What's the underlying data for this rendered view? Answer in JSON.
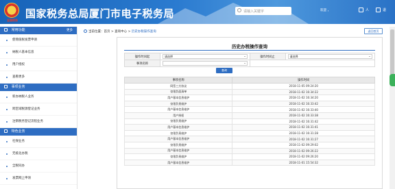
{
  "header": {
    "emblem_text": "全国税务",
    "title": "国家税务总局厦门市电子税务局",
    "search_placeholder": "请输入关键字",
    "search_button": "搜索",
    "welcome": "欢迎 ，",
    "user_label": "人",
    "logout_label": "退"
  },
  "sidebar": {
    "sections": [
      {
        "title": "常用功能",
        "more": "更多",
        "items": [
          "使增值税发票申请",
          "纳税人基本信息",
          "用户授权",
          "查看更多"
        ]
      },
      {
        "title": "事项业务",
        "items": [
          "新办纳税人业务",
          "跨区域税源登记业务",
          "注销税务登记流程业务"
        ]
      },
      {
        "title": "特色业务",
        "items": [
          "社保业务",
          "无纸化办税",
          "全税同办",
          "发票网上申领"
        ]
      }
    ]
  },
  "breadcrumb": {
    "label": "当前位置：",
    "home": "首页",
    "sep1": " > ",
    "center": "查询中心",
    "sep2": " > ",
    "current": "历史办税操作查询"
  },
  "back_button": "返回首页",
  "page_title": "历史办税操作查询",
  "form": {
    "time_start_label": "操作时间起",
    "time_start_value": "请选择",
    "time_end_label": "操作时间止",
    "time_end_value": "请选择",
    "item_label": "事项名称",
    "item_value": "",
    "query_button": "查询"
  },
  "grid": {
    "columns": [
      "事项名称",
      "操作时间"
    ],
    "rows": [
      [
        "网签三方协议",
        "2018-11-05 09:24:20"
      ],
      [
        "仅限负面清单",
        "2018-11-02 16:34:22"
      ],
      [
        "用户基本信息维护",
        "2018-11-02 16:34:20"
      ],
      [
        "仅限负责维护",
        "2018-11-02 16:33:42"
      ],
      [
        "用户基本信息维护",
        "2018-11-02 16:33:40"
      ],
      [
        "用户授权",
        "2018-11-02 16:33:38"
      ],
      [
        "仅限负责维护",
        "2018-11-02 16:31:42"
      ],
      [
        "用户基本信息维护",
        "2018-11-02 16:31:41"
      ],
      [
        "仅限负责维护",
        "2018-11-02 16:31:28"
      ],
      [
        "用户基本信息维护",
        "2018-11-02 16:31:27"
      ],
      [
        "仅限负责维护",
        "2018-11-02 09:29:02"
      ],
      [
        "用户基本信息维护",
        "2018-11-02 09:26:22"
      ],
      [
        "仅限负责维护",
        "2018-11-02 09:26:20"
      ],
      [
        "用户基本信息维护",
        "2018-11-01 15:54:32"
      ]
    ]
  }
}
